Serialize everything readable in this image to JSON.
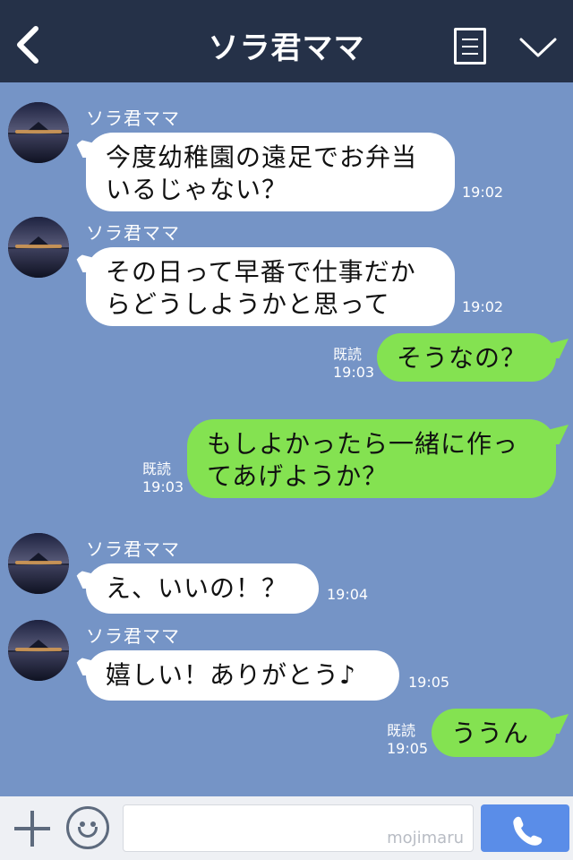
{
  "header": {
    "title": "ソラ君ママ"
  },
  "messages": [
    {
      "sender": "ソラ君ママ",
      "lines": [
        "今度幼稚園の遠足でお弁当",
        "いるじゃない？"
      ],
      "time": "19:02"
    },
    {
      "sender": "ソラ君ママ",
      "lines": [
        "その日って早番で仕事だか",
        "らどうしようかと思って"
      ],
      "time": "19:02"
    },
    {
      "read": "既読",
      "lines": [
        "そうなの？"
      ],
      "time": "19:03"
    },
    {
      "read": "既読",
      "lines": [
        "もしよかったら一緒に作っ",
        "てあげようか？"
      ],
      "time": "19:03"
    },
    {
      "sender": "ソラ君ママ",
      "lines": [
        "え、いいの！？"
      ],
      "time": "19:04"
    },
    {
      "sender": "ソラ君ママ",
      "lines": [
        "嬉しい！ありがとう♪"
      ],
      "time": "19:05"
    },
    {
      "read": "既読",
      "lines": [
        "ううん"
      ],
      "time": "19:05"
    }
  ],
  "footer": {
    "watermark": "mojimaru"
  },
  "icons": {
    "back": "back-arrow-icon",
    "menu": "menu-list-icon",
    "collapse": "chevron-down-icon",
    "add": "plus-icon",
    "emoji": "smiley-icon",
    "call": "phone-icon"
  },
  "colors": {
    "header_bg": "#253148",
    "chat_bg": "#7594c6",
    "incoming_bubble": "#ffffff",
    "outgoing_bubble": "#84e251",
    "call_button": "#5a8de8"
  }
}
